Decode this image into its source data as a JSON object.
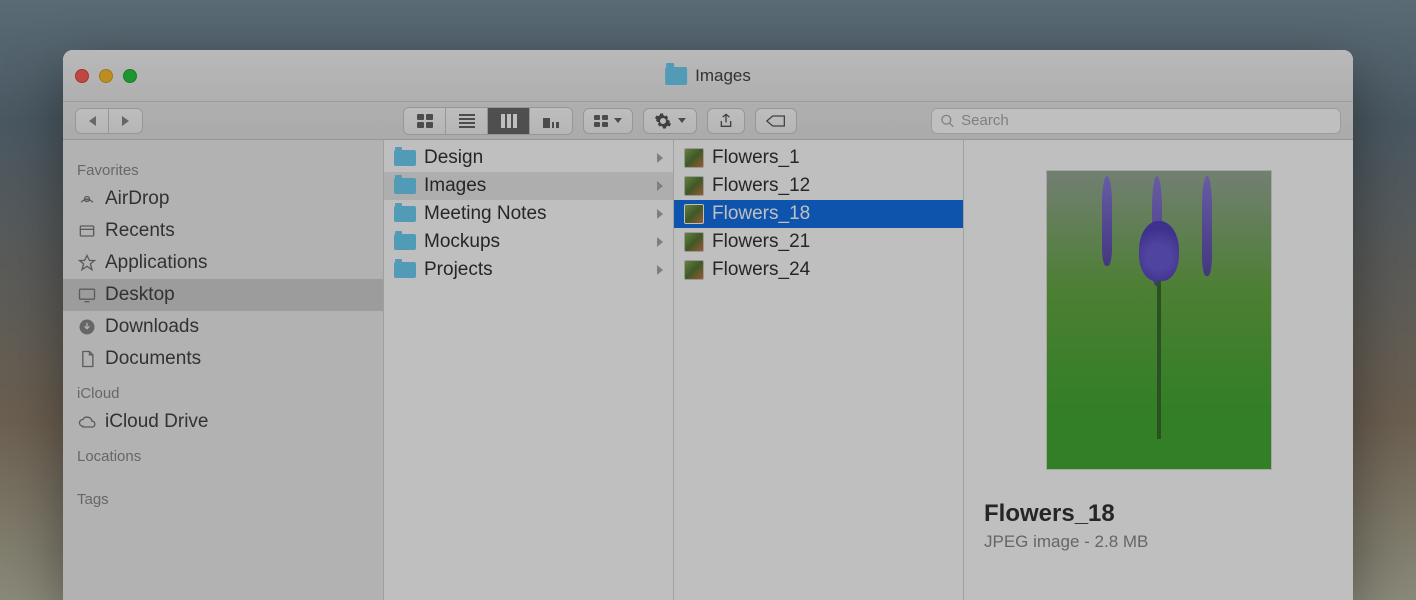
{
  "window": {
    "title": "Images"
  },
  "search": {
    "placeholder": "Search"
  },
  "sidebar": {
    "headings": {
      "favorites": "Favorites",
      "icloud": "iCloud",
      "locations": "Locations",
      "tags": "Tags"
    },
    "favorites": [
      {
        "icon": "airdrop",
        "label": "AirDrop"
      },
      {
        "icon": "recents",
        "label": "Recents"
      },
      {
        "icon": "apps",
        "label": "Applications"
      },
      {
        "icon": "desktop",
        "label": "Desktop",
        "selected": true
      },
      {
        "icon": "downloads",
        "label": "Downloads"
      },
      {
        "icon": "documents",
        "label": "Documents"
      }
    ],
    "icloud": [
      {
        "icon": "cloud",
        "label": "iCloud Drive"
      }
    ]
  },
  "columns": {
    "folders": [
      {
        "label": "Design"
      },
      {
        "label": "Images",
        "open": true
      },
      {
        "label": "Meeting Notes"
      },
      {
        "label": "Mockups"
      },
      {
        "label": "Projects"
      }
    ],
    "files": [
      {
        "label": "Flowers_1"
      },
      {
        "label": "Flowers_12"
      },
      {
        "label": "Flowers_18",
        "selected": true
      },
      {
        "label": "Flowers_21"
      },
      {
        "label": "Flowers_24"
      }
    ]
  },
  "preview": {
    "title": "Flowers_18",
    "type_size": "JPEG image - 2.8 MB"
  }
}
